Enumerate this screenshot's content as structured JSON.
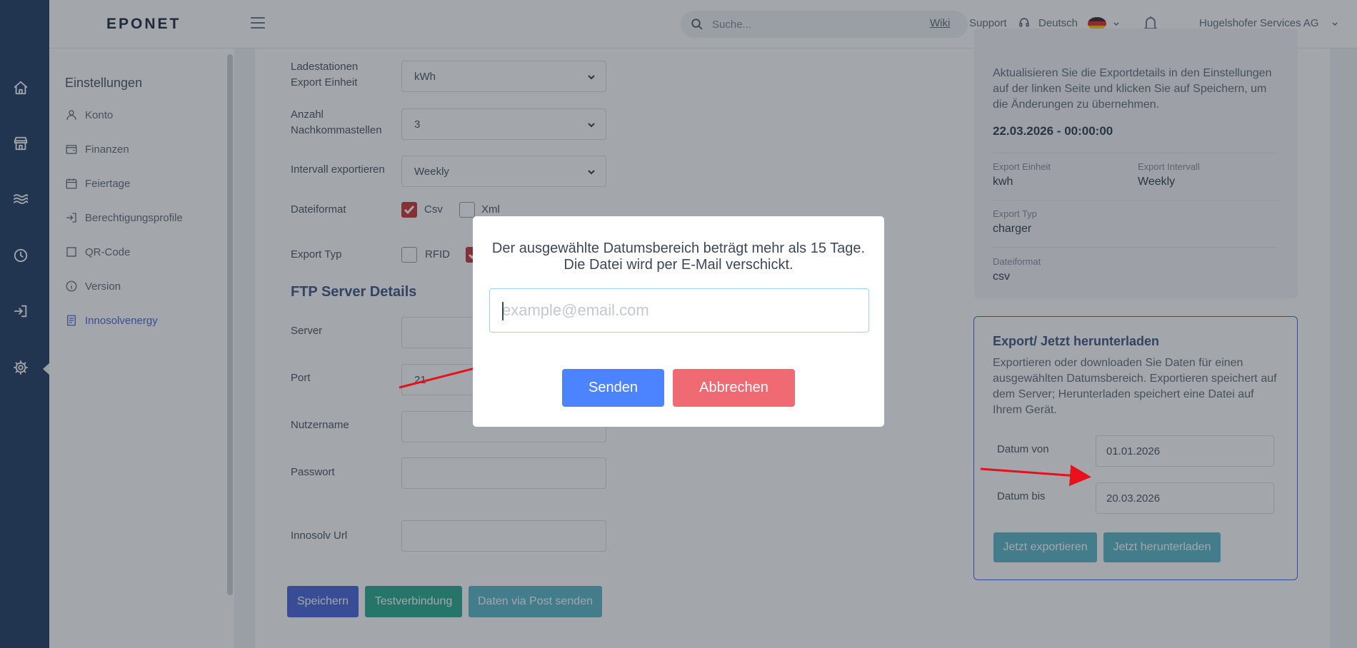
{
  "header": {
    "logo": "EPONET",
    "search_placeholder": "Suche...",
    "wiki": "Wiki",
    "support": "Support",
    "language": "Deutsch",
    "company": "Hugelshofer Services AG"
  },
  "rail": {
    "icons": [
      "home-icon",
      "store-icon",
      "waves-icon",
      "clock-icon",
      "login-icon",
      "settings-icon"
    ]
  },
  "submenu": {
    "title": "Einstellungen",
    "items": [
      {
        "label": "Konto",
        "icon": "user-icon"
      },
      {
        "label": "Finanzen",
        "icon": "wallet-icon"
      },
      {
        "label": "Feiertage",
        "icon": "calendar-icon"
      },
      {
        "label": "Berechtigungsprofile",
        "icon": "login-icon"
      },
      {
        "label": "QR-Code",
        "icon": "square-icon"
      },
      {
        "label": "Version",
        "icon": "info-icon"
      },
      {
        "label": "Innosolvenergy",
        "icon": "document-icon"
      }
    ]
  },
  "form": {
    "ladestation_label_1": "Ladestationen",
    "ladestation_label_2": "Export Einheit",
    "ladestation_value": "kWh",
    "decimals_label_1": "Anzahl",
    "decimals_label_2": "Nachkommastellen",
    "decimals_value": "3",
    "interval_label": "Intervall exportieren",
    "interval_value": "Weekly",
    "fileformat_label": "Dateiformat",
    "csv_label": "Csv",
    "xml_label": "Xml",
    "export_type_label": "Export Typ",
    "rfid_label": "RFID",
    "ftp_heading": "FTP Server Details",
    "server_label": "Server",
    "port_label": "Port",
    "port_value": "21",
    "username_label": "Nutzername",
    "password_label": "Passwort",
    "innosolv_label": "Innosolv Url",
    "save_button": "Speichern",
    "test_button": "Testverbindung",
    "post_button": "Daten via Post senden"
  },
  "info": {
    "text": "Aktualisieren Sie die Exportdetails in den Einstellungen auf der linken Seite und klicken Sie auf Speichern, um die Änderungen zu übernehmen.",
    "date": "22.03.2026 - 00:00:00",
    "unit_label": "Export Einheit",
    "unit_value": "kwh",
    "interval_label": "Export Intervall",
    "interval_value": "Weekly",
    "type_label": "Export Typ",
    "type_value": "charger",
    "format_label": "Dateiformat",
    "format_value": "csv"
  },
  "export": {
    "title": "Export/ Jetzt herunterladen",
    "desc": "Exportieren oder downloaden Sie Daten für einen ausgewählten Datumsbereich. Exportieren speichert auf dem Server; Herunterladen speichert eine Datei auf Ihrem Gerät.",
    "from_label": "Datum von",
    "from_value": "01.01.2026",
    "to_label": "Datum bis",
    "to_value": "20.03.2026",
    "export_button": "Jetzt exportieren",
    "download_button": "Jetzt herunterladen"
  },
  "modal": {
    "message_line1": "Der ausgewählte Datumsbereich beträgt mehr als 15 Tage.",
    "message_line2": "Die Datei wird per E-Mail verschickt.",
    "email_placeholder": "example@email.com",
    "email_value": "",
    "send_button": "Senden",
    "cancel_button": "Abbrechen"
  },
  "colors": {
    "rail": "#0f2f5a",
    "primary": "#3b5bdb",
    "send": "#4c84ff",
    "cancel": "#f06a74",
    "teal": "#17a589",
    "cyan": "#4fb3c8",
    "checkbox": "#c62828",
    "arrow": "#e8101a"
  }
}
